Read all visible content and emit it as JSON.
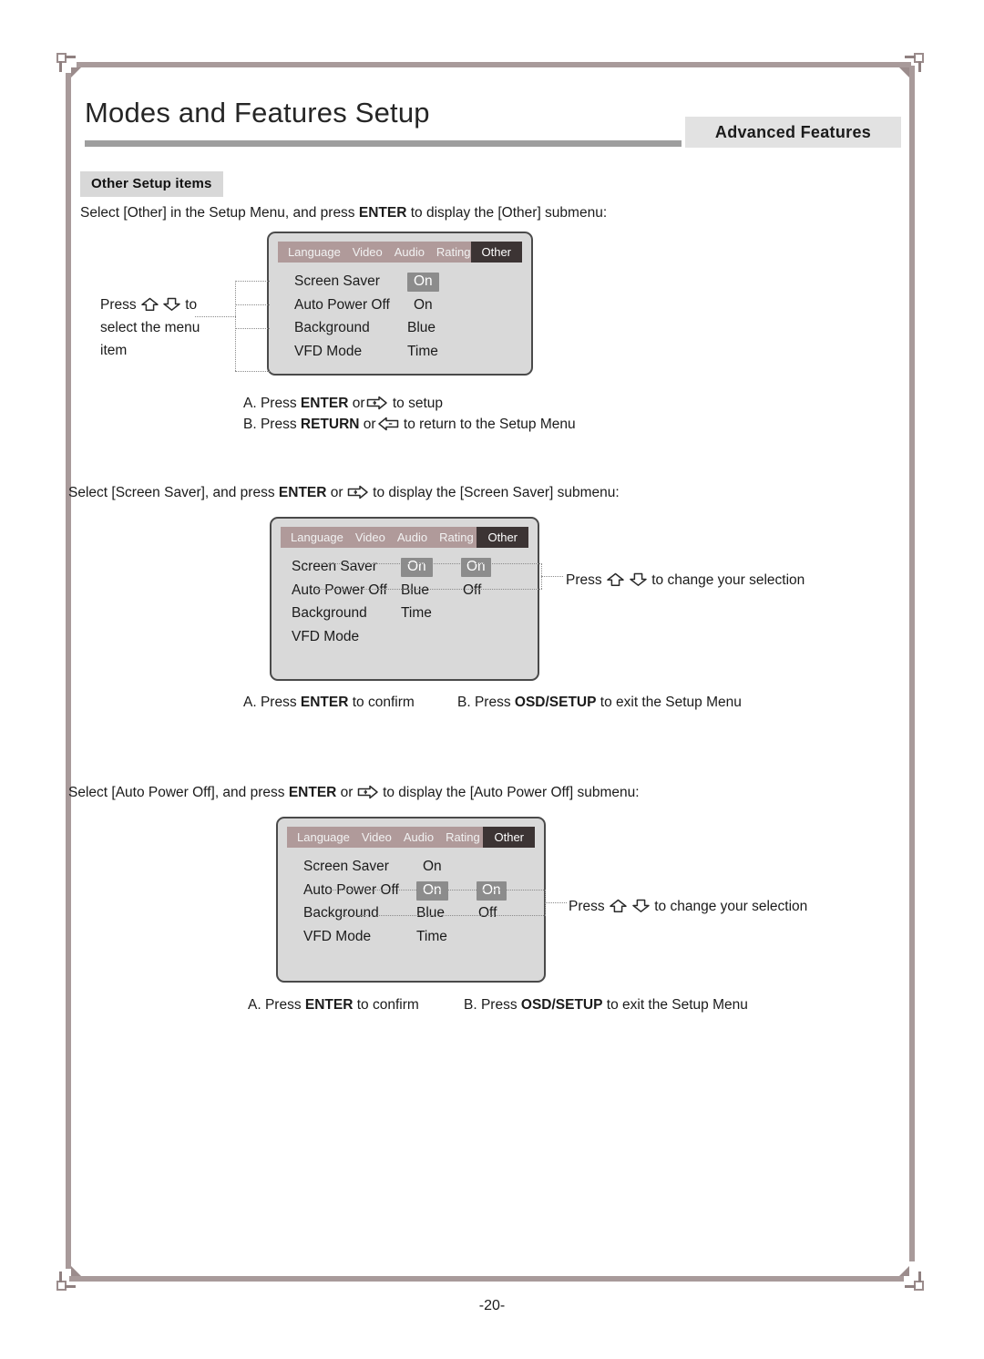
{
  "document": {
    "title": "Modes and Features Setup",
    "banner": "Advanced Features",
    "section_tag": "Other Setup items",
    "page_number": "-20-"
  },
  "intro": {
    "line1_pre": "Select [Other] in the Setup Menu, and press ",
    "line1_bold": "ENTER",
    "line1_post": " to display the [Other] submenu:",
    "line2_pre": "Select [Screen Saver], and press ",
    "line2_bold": "ENTER",
    "line2_mid": " or ",
    "line2_post": " to display the [Screen Saver] submenu:",
    "line3_pre": "Select [Auto Power Off], and press ",
    "line3_bold": "ENTER",
    "line3_mid": " or ",
    "line3_post": " to display the [Auto Power Off] submenu:"
  },
  "osd_tabs": [
    "Language",
    "Video",
    "Audio",
    "Rating",
    "Other"
  ],
  "osd_active_tab": "Other",
  "menu_items": [
    "Screen Saver",
    "Auto Power Off",
    "Background",
    "VFD Mode"
  ],
  "box1": {
    "values": [
      "On",
      "On",
      "Blue",
      "Time"
    ],
    "highlighted_index": 0
  },
  "box2": {
    "values": [
      "On",
      "Blue",
      "Time"
    ],
    "highlighted_index": 0,
    "submenu_options": [
      "On",
      "Off"
    ],
    "submenu_highlighted_index": 0
  },
  "box3": {
    "values": [
      "On",
      "On",
      "Blue",
      "Time"
    ],
    "highlighted_index": 1,
    "submenu_options": [
      "On",
      "Off"
    ],
    "submenu_highlighted_index": 0
  },
  "annotations": {
    "left_note_pre": "Press ",
    "left_note_post": " to",
    "left_note_line2": "select the menu",
    "left_note_line3": "item",
    "change_selection_pre": "Press ",
    "change_selection_post": " to change your selection"
  },
  "notes": {
    "b1a_letter": "A.",
    "b1a_pre": " Press ",
    "b1a_bold": "ENTER",
    "b1a_mid": " or",
    "b1a_post": " to setup",
    "b1b_letter": "B.",
    "b1b_pre": " Press ",
    "b1b_bold": "RETURN",
    "b1b_mid": " or",
    "b1b_post": " to return to the Setup Menu",
    "confirm_letter": "A.",
    "confirm_pre": " Press ",
    "confirm_bold": "ENTER",
    "confirm_post": " to confirm",
    "exit_letter": "B.",
    "exit_pre": " Press ",
    "exit_bold": "OSD/SETUP",
    "exit_post": " to exit the Setup Menu"
  },
  "colors": {
    "tabbar": "#b09a9a",
    "active_tab": "#3c3434",
    "osd_background": "#d9d9d9",
    "highlight": "#8c8c8c",
    "frame": "#a89a9a",
    "banner": "#e2e2e2"
  }
}
